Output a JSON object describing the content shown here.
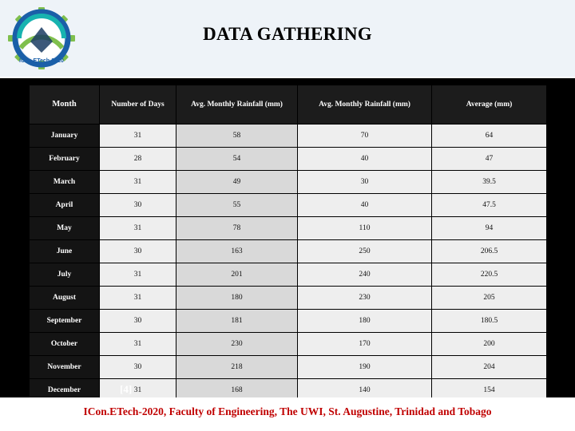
{
  "slide": {
    "title": "DATA GATHERING",
    "citation": "[4]",
    "footer": "ICon.ETech-2020, Faculty of Engineering, The UWI, St. Augustine, Trinidad and Tobago",
    "accent_color": "#c00000",
    "header_band_color": "#eef3f8",
    "body_color": "#000000"
  },
  "logo": {
    "name": "icon-etech-2020-logo",
    "text": "ICon.ETech-2020"
  },
  "table": {
    "columns": [
      "Month",
      "Number of Days",
      "Avg. Monthly Rainfall (mm)",
      "Avg. Monthly Rainfall (mm)",
      "Average (mm)"
    ],
    "rows": [
      [
        "January",
        "31",
        "58",
        "70",
        "64"
      ],
      [
        "February",
        "28",
        "54",
        "40",
        "47"
      ],
      [
        "March",
        "31",
        "49",
        "30",
        "39.5"
      ],
      [
        "April",
        "30",
        "55",
        "40",
        "47.5"
      ],
      [
        "May",
        "31",
        "78",
        "110",
        "94"
      ],
      [
        "June",
        "30",
        "163",
        "250",
        "206.5"
      ],
      [
        "July",
        "31",
        "201",
        "240",
        "220.5"
      ],
      [
        "August",
        "31",
        "180",
        "230",
        "205"
      ],
      [
        "September",
        "30",
        "181",
        "180",
        "180.5"
      ],
      [
        "October",
        "31",
        "230",
        "170",
        "200"
      ],
      [
        "November",
        "30",
        "218",
        "190",
        "204"
      ],
      [
        "December",
        "31",
        "168",
        "140",
        "154"
      ]
    ]
  }
}
